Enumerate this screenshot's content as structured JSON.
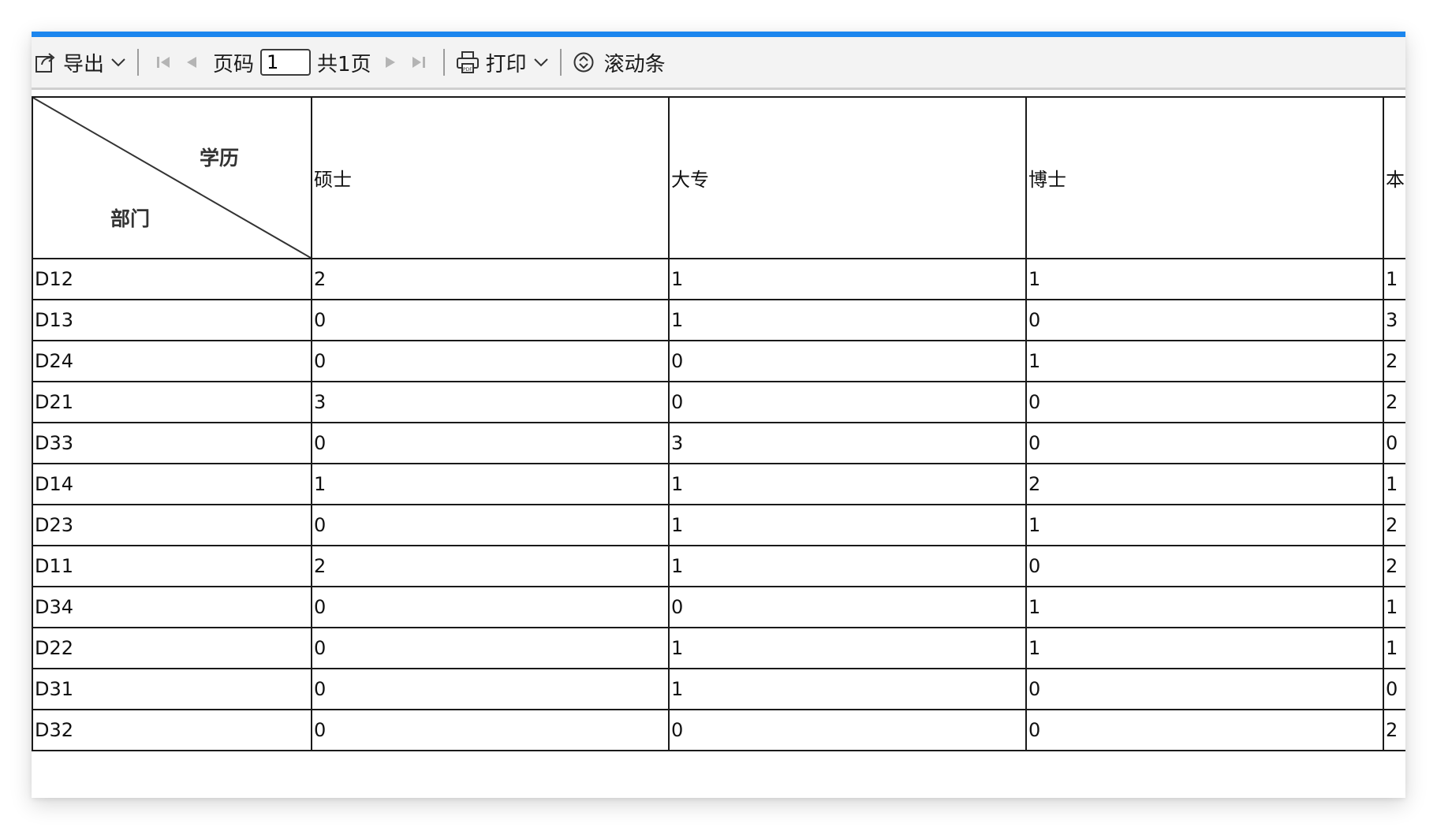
{
  "toolbar": {
    "export_label": "导出",
    "page_label": "页码",
    "page_value": "1",
    "total_pages": "共1页",
    "print_label": "打印",
    "scroll_label": "滚动条"
  },
  "table": {
    "corner_top": "学历",
    "corner_bottom": "部门",
    "columns": [
      "硕士",
      "大专",
      "博士",
      "本"
    ],
    "rows": [
      {
        "dept": "D12",
        "values": [
          "2",
          "1",
          "1",
          "1"
        ]
      },
      {
        "dept": "D13",
        "values": [
          "0",
          "1",
          "0",
          "3"
        ]
      },
      {
        "dept": "D24",
        "values": [
          "0",
          "0",
          "1",
          "2"
        ]
      },
      {
        "dept": "D21",
        "values": [
          "3",
          "0",
          "0",
          "2"
        ]
      },
      {
        "dept": "D33",
        "values": [
          "0",
          "3",
          "0",
          "0"
        ]
      },
      {
        "dept": "D14",
        "values": [
          "1",
          "1",
          "2",
          "1"
        ]
      },
      {
        "dept": "D23",
        "values": [
          "0",
          "1",
          "1",
          "2"
        ]
      },
      {
        "dept": "D11",
        "values": [
          "2",
          "1",
          "0",
          "2"
        ]
      },
      {
        "dept": "D34",
        "values": [
          "0",
          "0",
          "1",
          "1"
        ]
      },
      {
        "dept": "D22",
        "values": [
          "0",
          "1",
          "1",
          "1"
        ]
      },
      {
        "dept": "D31",
        "values": [
          "0",
          "1",
          "0",
          "0"
        ]
      },
      {
        "dept": "D32",
        "values": [
          "0",
          "0",
          "0",
          "2"
        ]
      }
    ]
  },
  "colors": {
    "accent": "#1c86ee",
    "toolbar_bg": "#f3f3f3",
    "border": "#1a1a1a"
  },
  "icons": [
    "export-icon",
    "chevron-down-icon",
    "first-page-icon",
    "prev-page-icon",
    "next-page-icon",
    "last-page-icon",
    "pdf-print-icon",
    "scrollbar-icon"
  ]
}
